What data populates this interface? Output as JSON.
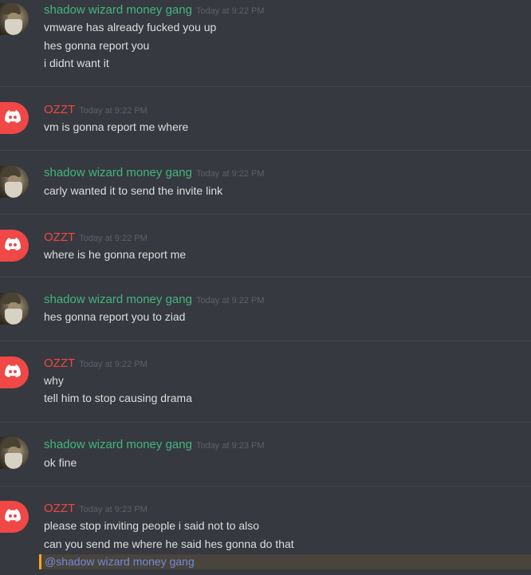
{
  "messages": [
    {
      "author": "shadow wizard money gang",
      "author_color": "#43b581",
      "avatar_icon": "wizard-avatar-icon",
      "timestamp": "Today at 9:22 PM",
      "lines": [
        "vmware has already fucked you up",
        "hes gonna report you",
        "i didnt want it"
      ]
    },
    {
      "author": "OZZT",
      "author_color": "#f04747",
      "avatar_icon": "discord-avatar-icon",
      "timestamp": "Today at 9:22 PM",
      "lines": [
        "vm is gonna report me where"
      ]
    },
    {
      "author": "shadow wizard money gang",
      "author_color": "#43b581",
      "avatar_icon": "wizard-avatar-icon",
      "timestamp": "Today at 9:22 PM",
      "lines": [
        "carly wanted it to send the invite link"
      ]
    },
    {
      "author": "OZZT",
      "author_color": "#f04747",
      "avatar_icon": "discord-avatar-icon",
      "timestamp": "Today at 9:22 PM",
      "lines": [
        "where is he gonna report me"
      ]
    },
    {
      "author": "shadow wizard money gang",
      "author_color": "#43b581",
      "avatar_icon": "wizard-avatar-icon",
      "timestamp": "Today at 9:22 PM",
      "lines": [
        "hes gonna report you to ziad"
      ]
    },
    {
      "author": "OZZT",
      "author_color": "#f04747",
      "avatar_icon": "discord-avatar-icon",
      "timestamp": "Today at 9:22 PM",
      "lines": [
        "why",
        "tell him to stop causing drama"
      ]
    },
    {
      "author": "shadow wizard money gang",
      "author_color": "#43b581",
      "avatar_icon": "wizard-avatar-icon",
      "timestamp": "Today at 9:23 PM",
      "lines": [
        "ok fine"
      ]
    },
    {
      "author": "OZZT",
      "author_color": "#f04747",
      "avatar_icon": "discord-avatar-icon",
      "timestamp": "Today at 9:23 PM",
      "lines": [
        "please stop inviting people i said not to also",
        "can you send me where he said hes gonna do that"
      ],
      "mention": "@shadow wizard money gang"
    }
  ],
  "colors": {
    "background": "#36393f",
    "divider": "#42454a",
    "text": "#dcddde",
    "timestamp": "#5d6168",
    "mention": "#7289da",
    "mention_highlight": "#49443c",
    "mention_bar": "#faa61a"
  }
}
